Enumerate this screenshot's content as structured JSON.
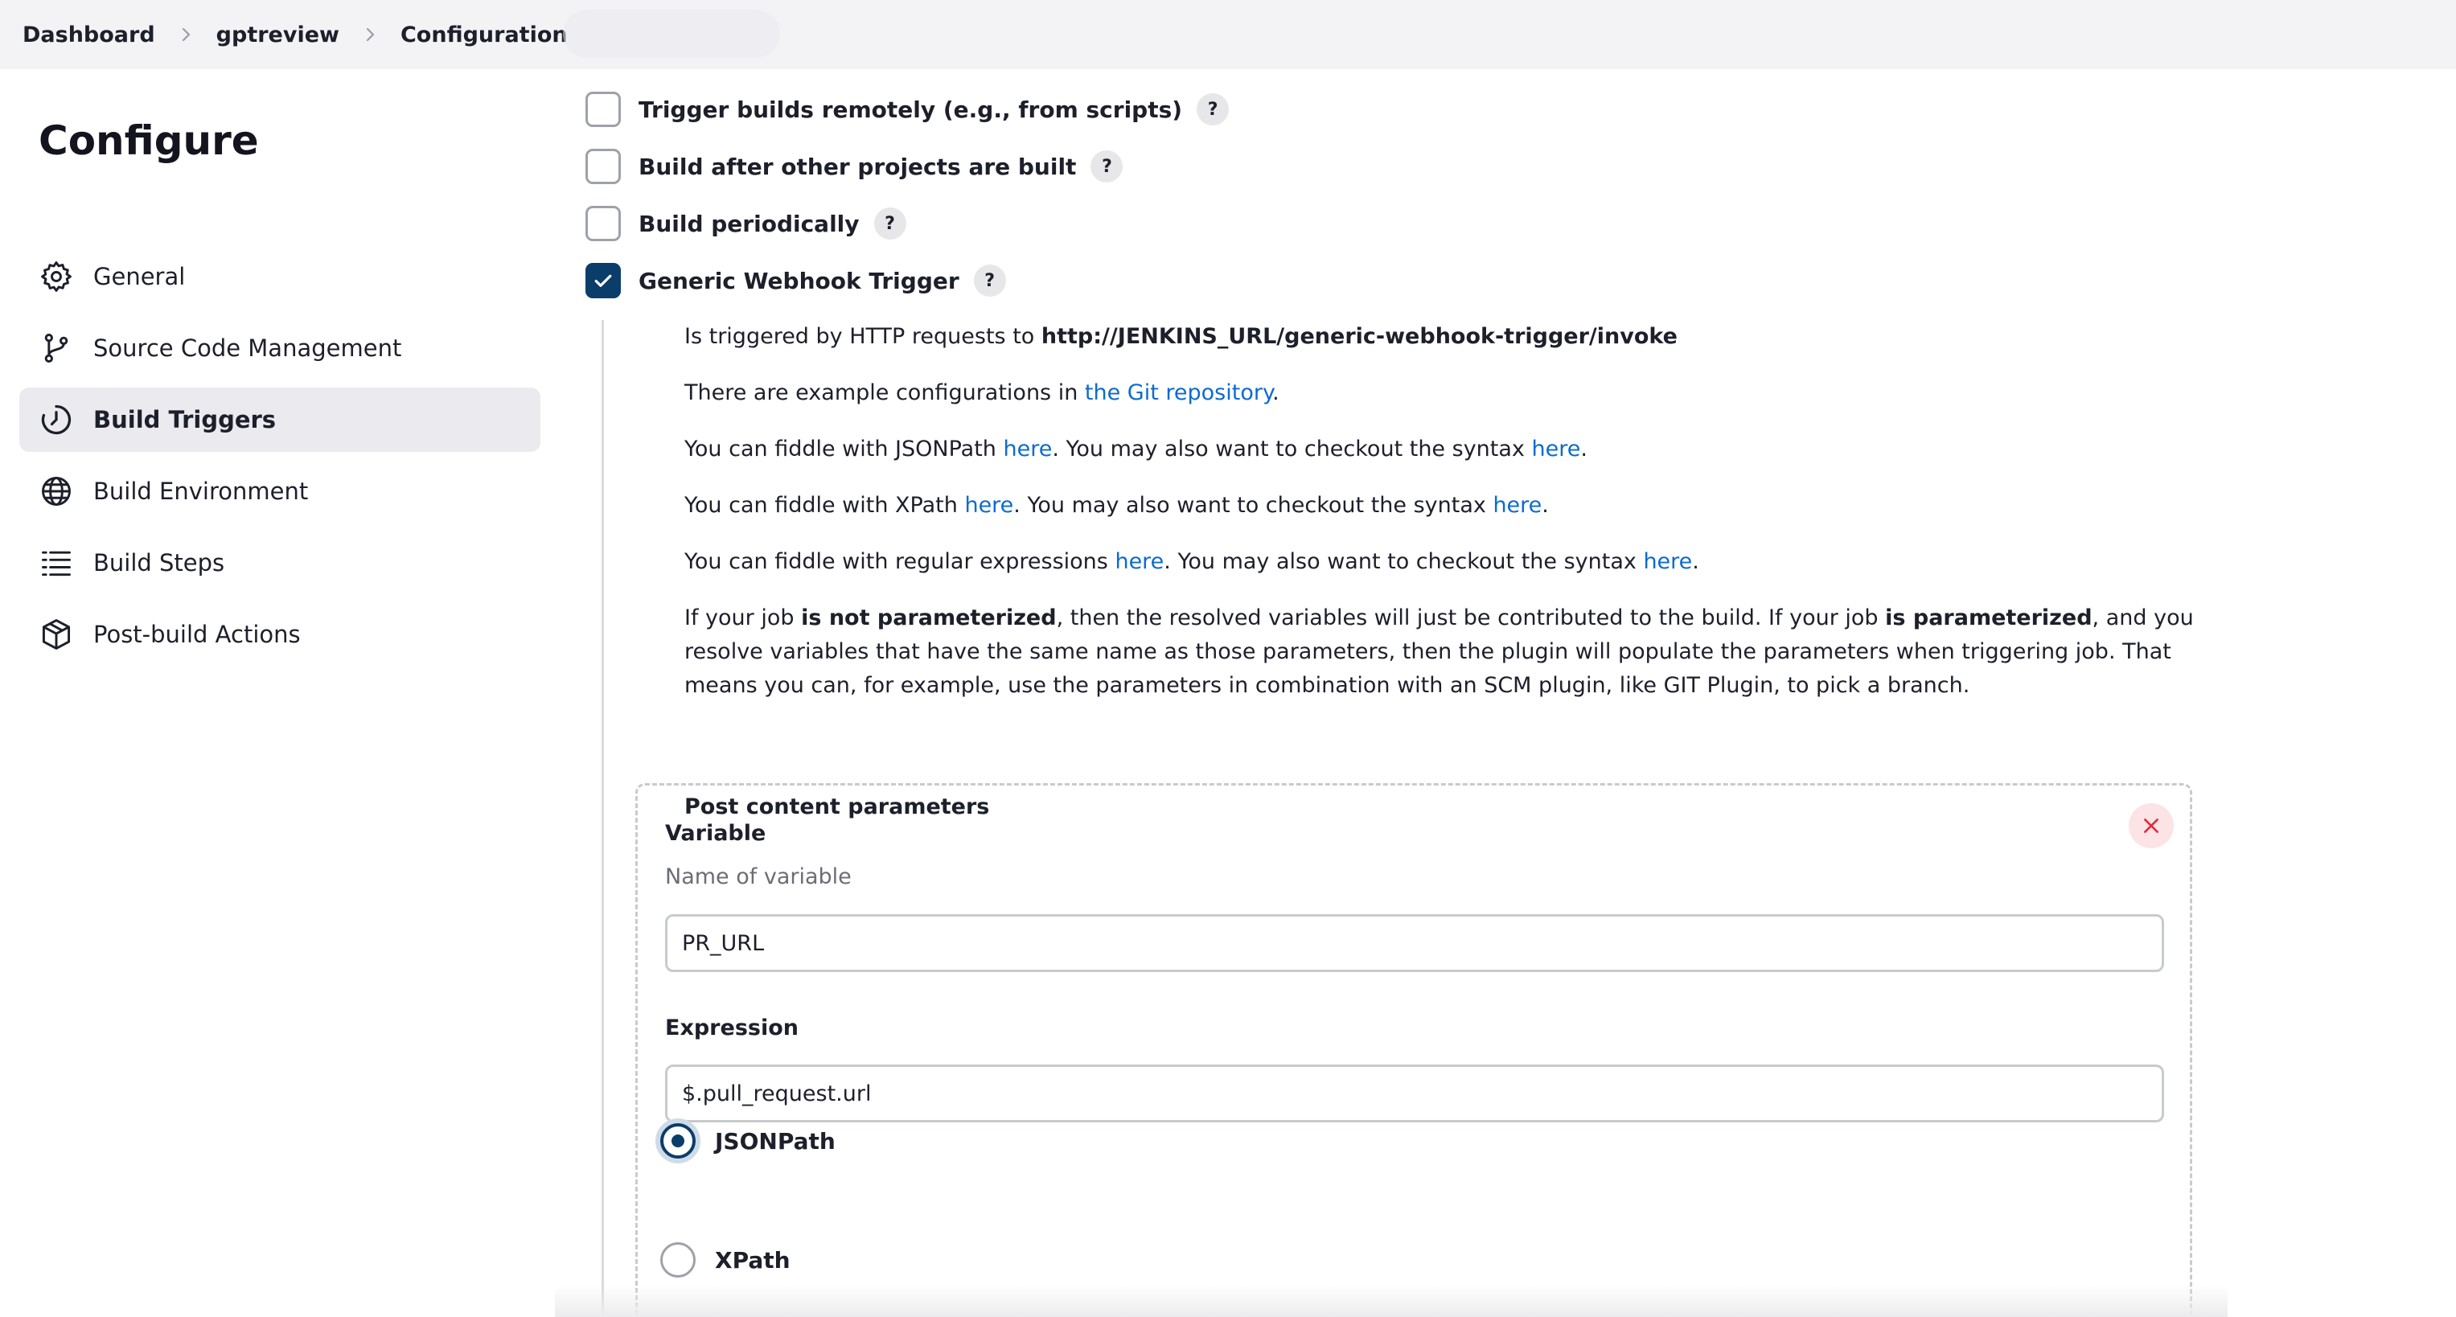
{
  "breadcrumb": {
    "items": [
      "Dashboard",
      "gptreview",
      "Configuration"
    ]
  },
  "sidebar": {
    "title": "Configure",
    "items": [
      {
        "label": "General",
        "icon": "gear-icon"
      },
      {
        "label": "Source Code Management",
        "icon": "git-branch-icon"
      },
      {
        "label": "Build Triggers",
        "icon": "timer-icon",
        "active": true
      },
      {
        "label": "Build Environment",
        "icon": "globe-icon"
      },
      {
        "label": "Build Steps",
        "icon": "list-icon"
      },
      {
        "label": "Post-build Actions",
        "icon": "package-icon"
      }
    ]
  },
  "triggers": [
    {
      "label": "Trigger builds remotely (e.g., from scripts)",
      "checked": false
    },
    {
      "label": "Build after other projects are built",
      "checked": false
    },
    {
      "label": "Build periodically",
      "checked": false
    },
    {
      "label": "Generic Webhook Trigger",
      "checked": true
    }
  ],
  "help_label": "?",
  "webhook": {
    "url_prefix": "Is triggered by HTTP requests to ",
    "url": "http://JENKINS_URL/generic-webhook-trigger/invoke",
    "examples_prefix": "There are example configurations in ",
    "examples_link": "the Git repository",
    "examples_suffix": ".",
    "jsonpath_prefix": "You can fiddle with JSONPath ",
    "xpath_prefix": "You can fiddle with XPath ",
    "regex_prefix": "You can fiddle with regular expressions ",
    "here": "here",
    "syntax_mid": ". You may also want to checkout the syntax ",
    "period": ".",
    "param_1": "If your job ",
    "param_2": "is not parameterized",
    "param_3": ", then the resolved variables will just be contributed to the build. If your job ",
    "param_4": "is parameterized",
    "param_5": ", and you resolve variables that have the same name as those parameters, then the plugin will populate the parameters when triggering job. That means you can, for example, use the parameters in combination with an SCM plugin, like GIT Plugin, to pick a branch.",
    "post_content_title": "Post content parameters"
  },
  "param": {
    "variable_label": "Variable",
    "variable_hint": "Name of variable",
    "variable_value": "PR_URL",
    "expression_label": "Expression",
    "expression_value": "$.pull_request.url",
    "radio_options": [
      {
        "label": "JSONPath",
        "checked": true
      },
      {
        "label": "XPath",
        "checked": false
      }
    ]
  },
  "colors": {
    "accent": "#0b3d6a",
    "link": "#0c6bd0",
    "remove": "#e02a3d"
  }
}
